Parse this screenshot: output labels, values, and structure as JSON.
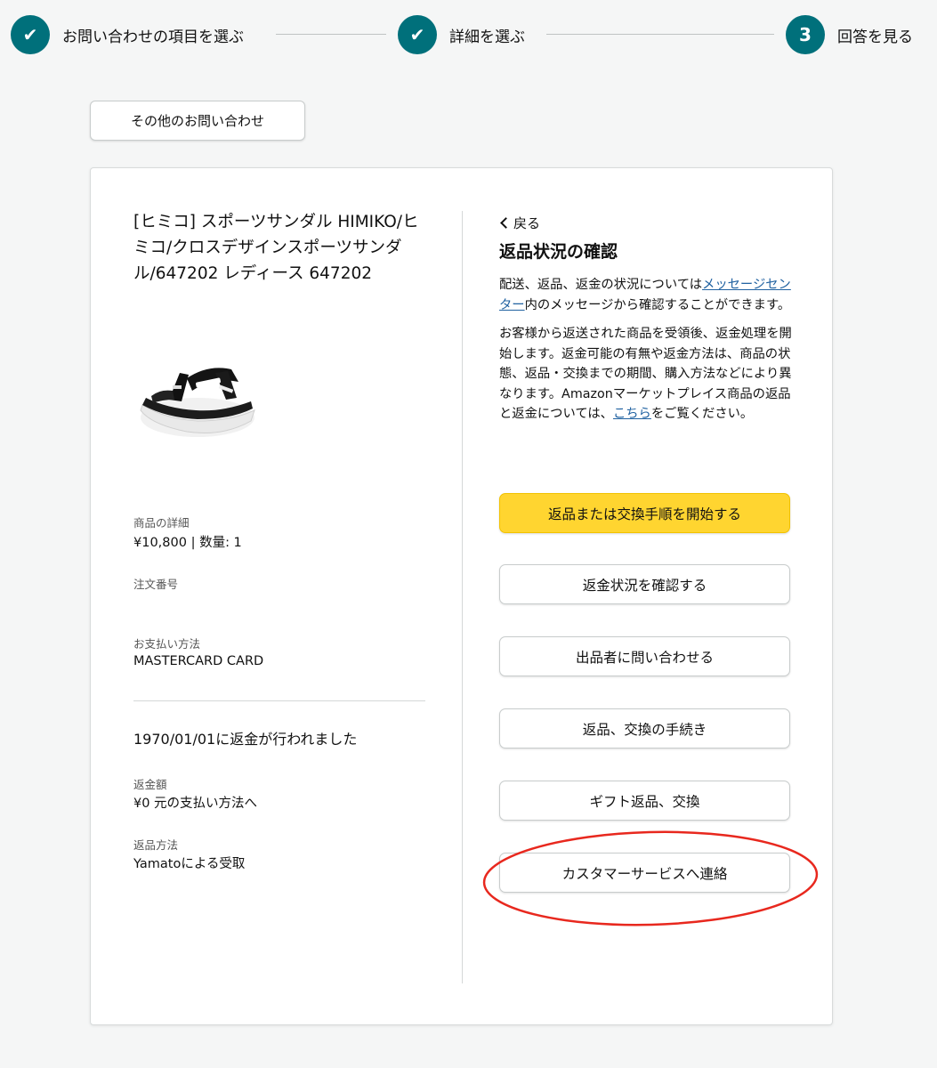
{
  "stepper": {
    "steps": [
      {
        "label": "お問い合わせの項目を選ぶ",
        "state": "done",
        "marker": "✔"
      },
      {
        "label": "詳細を選ぶ",
        "state": "done",
        "marker": "✔"
      },
      {
        "label": "回答を見る",
        "state": "current",
        "marker": "3"
      }
    ],
    "accent_color": "#00707b"
  },
  "other_inquiry_label": "その他のお問い合わせ",
  "product": {
    "title": "[ヒミコ] スポーツサンダル HIMIKO/ヒミコ/クロスデザインスポーツサンダル/647202 レディース 647202",
    "image_icon": "sandal-product-image",
    "details_label": "商品の詳細",
    "details_value": "¥10,800 | 数量: 1",
    "order_number_label": "注文番号",
    "payment_label": "お支払い方法",
    "payment_value": "MASTERCARD CARD",
    "refund_status": "1970/01/01に返金が行われました",
    "refund_amount_label": "返金額",
    "refund_amount_value": "¥0 元の支払い方法へ",
    "return_method_label": "返品方法",
    "return_method_value": "Yamatoによる受取"
  },
  "panel": {
    "back_label": "戻る",
    "title": "返品状況の確認",
    "para1_before": "配送、返品、返金の状況については",
    "para1_link": "メッセージセンター",
    "para1_after": "内のメッセージから確認することができます。",
    "para2_before": "お客様から返送された商品を受領後、返金処理を開始します。返金可能の有無や返金方法は、商品の状態、返品・交換までの期間、購入方法などにより異なります。Amazonマーケットプレイス商品の返品と返金については、",
    "para2_link": "こちら",
    "para2_after": "をご覧ください。",
    "link_color": "#2162a1"
  },
  "buttons": {
    "start_return": "返品または交換手順を開始する",
    "check_refund": "返金状況を確認する",
    "contact_seller": "出品者に問い合わせる",
    "return_procedure": "返品、交換の手続き",
    "gift_return": "ギフト返品、交換",
    "contact_cs": "カスタマーサービスへ連絡",
    "primary_color": "#ffd530"
  },
  "annotation": {
    "color": "#e8281e"
  }
}
